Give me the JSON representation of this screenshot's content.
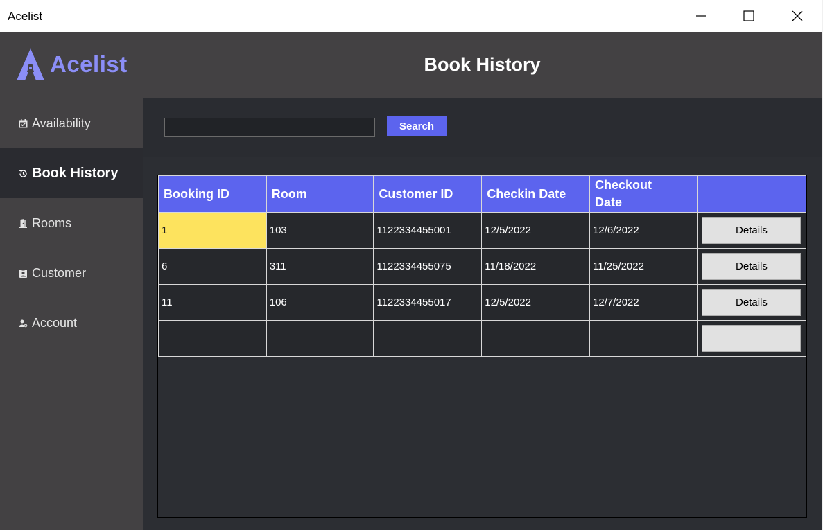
{
  "window": {
    "title": "Acelist",
    "controls": [
      "minimize-icon",
      "maximize-icon",
      "close-icon"
    ]
  },
  "header": {
    "logo_text": "Acelist",
    "page_title": "Book History"
  },
  "sidebar": {
    "items": [
      {
        "label": "Availability",
        "icon": "calendar-check-icon",
        "active": false
      },
      {
        "label": "Book History",
        "icon": "history-icon",
        "active": true
      },
      {
        "label": "Rooms",
        "icon": "door-icon",
        "active": false
      },
      {
        "label": "Customer",
        "icon": "id-badge-icon",
        "active": false
      },
      {
        "label": "Account",
        "icon": "user-gear-icon",
        "active": false
      }
    ]
  },
  "search": {
    "value": "",
    "button_label": "Search"
  },
  "table": {
    "columns": [
      "Booking ID",
      "Room",
      "Customer ID",
      "Checkin Date",
      "Checkout Date",
      ""
    ],
    "rows": [
      {
        "booking_id": "1",
        "room": "103",
        "customer_id": "1122334455001",
        "checkin": "12/5/2022",
        "checkout": "12/6/2022",
        "action": "Details",
        "selected": true
      },
      {
        "booking_id": "6",
        "room": "311",
        "customer_id": "1122334455075",
        "checkin": "11/18/2022",
        "checkout": "11/25/2022",
        "action": "Details",
        "selected": false
      },
      {
        "booking_id": "11",
        "room": "106",
        "customer_id": "1122334455017",
        "checkin": "12/5/2022",
        "checkout": "12/7/2022",
        "action": "Details",
        "selected": false
      },
      {
        "booking_id": "",
        "room": "",
        "customer_id": "",
        "checkin": "",
        "checkout": "",
        "action": "",
        "selected": false
      }
    ]
  },
  "colors": {
    "accent": "#5c64ee",
    "logo": "#8b8ef7",
    "panel": "#434143",
    "main_bg": "#2c2e33",
    "selected_cell": "#fde35e"
  }
}
